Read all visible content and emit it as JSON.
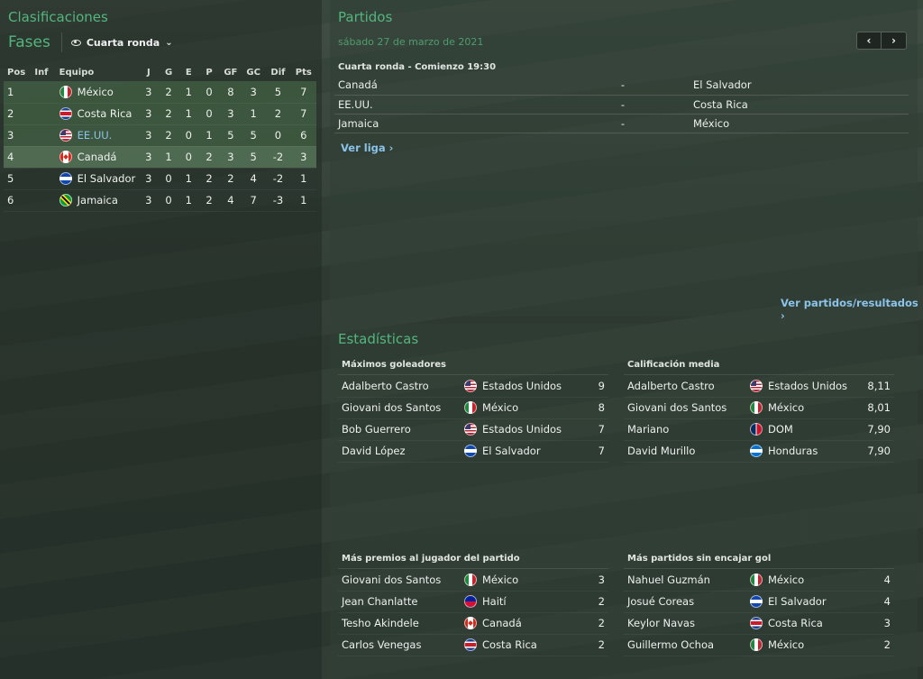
{
  "standings": {
    "title": "Clasificaciones",
    "stage_label": "Fases",
    "stage_select": "Cuarta ronda",
    "columns": [
      "Pos",
      "Inf",
      "Equipo",
      "J",
      "G",
      "E",
      "P",
      "GF",
      "GC",
      "Dif",
      "Pts"
    ],
    "rows": [
      {
        "pos": "1",
        "inf": "",
        "team": "México",
        "flag": "mx",
        "j": "3",
        "g": "2",
        "e": "1",
        "p": "0",
        "gf": "8",
        "gc": "3",
        "dif": "5",
        "pts": "7"
      },
      {
        "pos": "2",
        "inf": "",
        "team": "Costa Rica",
        "flag": "cr",
        "j": "3",
        "g": "2",
        "e": "1",
        "p": "0",
        "gf": "3",
        "gc": "1",
        "dif": "2",
        "pts": "7"
      },
      {
        "pos": "3",
        "inf": "",
        "team": "EE.UU.",
        "flag": "us",
        "j": "3",
        "g": "2",
        "e": "0",
        "p": "1",
        "gf": "5",
        "gc": "5",
        "dif": "0",
        "pts": "6"
      },
      {
        "pos": "4",
        "inf": "",
        "team": "Canadá",
        "flag": "ca",
        "j": "3",
        "g": "1",
        "e": "0",
        "p": "2",
        "gf": "3",
        "gc": "5",
        "dif": "-2",
        "pts": "3"
      },
      {
        "pos": "5",
        "inf": "",
        "team": "El Salvador",
        "flag": "sv",
        "j": "3",
        "g": "0",
        "e": "1",
        "p": "2",
        "gf": "2",
        "gc": "4",
        "dif": "-2",
        "pts": "1"
      },
      {
        "pos": "6",
        "inf": "",
        "team": "Jamaica",
        "flag": "jm",
        "j": "3",
        "g": "0",
        "e": "1",
        "p": "2",
        "gf": "4",
        "gc": "7",
        "dif": "-3",
        "pts": "1"
      }
    ]
  },
  "matches": {
    "title": "Partidos",
    "date": "sábado 27 de marzo de 2021",
    "prev_icon": "‹",
    "next_icon": "›",
    "round_heading": "Cuarta ronda - Comienzo 19:30",
    "rows": [
      {
        "home": "Canadá",
        "sep": "-",
        "away": "El Salvador",
        "home_link": false
      },
      {
        "home": "EE.UU.",
        "sep": "-",
        "away": "Costa Rica",
        "home_link": true
      },
      {
        "home": "Jamaica",
        "sep": "-",
        "away": "México",
        "home_link": false
      }
    ],
    "league_link": "Ver liga",
    "results_link": "Ver partidos/resultados"
  },
  "stats": {
    "title": "Estadísticas",
    "top_scorers": {
      "heading": "Máximos goleadores",
      "rows": [
        {
          "name": "Adalberto Castro",
          "link": true,
          "flag": "us",
          "country": "Estados Unidos",
          "value": "9"
        },
        {
          "name": "Giovani dos Santos",
          "link": false,
          "flag": "mx",
          "country": "México",
          "value": "8"
        },
        {
          "name": "Bob Guerrero",
          "link": true,
          "flag": "us",
          "country": "Estados Unidos",
          "value": "7"
        },
        {
          "name": "David López",
          "link": false,
          "flag": "sv",
          "country": "El Salvador",
          "value": "7"
        }
      ]
    },
    "avg_rating": {
      "heading": "Calificación media",
      "rows": [
        {
          "name": "Adalberto Castro",
          "link": true,
          "flag": "us",
          "country": "Estados Unidos",
          "value": "8,11"
        },
        {
          "name": "Giovani dos Santos",
          "link": false,
          "flag": "mx",
          "country": "México",
          "value": "8,01"
        },
        {
          "name": "Mariano",
          "link": false,
          "flag": "do",
          "country": "DOM",
          "value": "7,90"
        },
        {
          "name": "David Murillo",
          "link": false,
          "flag": "hn",
          "country": "Honduras",
          "value": "7,90"
        }
      ]
    },
    "potm": {
      "heading": "Más premios al jugador del partido",
      "rows": [
        {
          "name": "Giovani dos Santos",
          "link": false,
          "flag": "mx",
          "country": "México",
          "value": "3"
        },
        {
          "name": "Jean Chanlatte",
          "link": false,
          "flag": "ht",
          "country": "Haití",
          "value": "2"
        },
        {
          "name": "Tesho Akindele",
          "link": false,
          "flag": "ca",
          "country": "Canadá",
          "value": "2"
        },
        {
          "name": "Carlos Venegas",
          "link": false,
          "flag": "cr",
          "country": "Costa Rica",
          "value": "2"
        }
      ]
    },
    "clean_sheets": {
      "heading": "Más partidos sin encajar gol",
      "rows": [
        {
          "name": "Nahuel Guzmán",
          "link": false,
          "flag": "mx",
          "country": "México",
          "value": "4"
        },
        {
          "name": "Josué Coreas",
          "link": false,
          "flag": "sv",
          "country": "El Salvador",
          "value": "4"
        },
        {
          "name": "Keylor Navas",
          "link": false,
          "flag": "cr",
          "country": "Costa Rica",
          "value": "3"
        },
        {
          "name": "Guillermo Ochoa",
          "link": false,
          "flag": "mx",
          "country": "México",
          "value": "2"
        }
      ]
    }
  }
}
